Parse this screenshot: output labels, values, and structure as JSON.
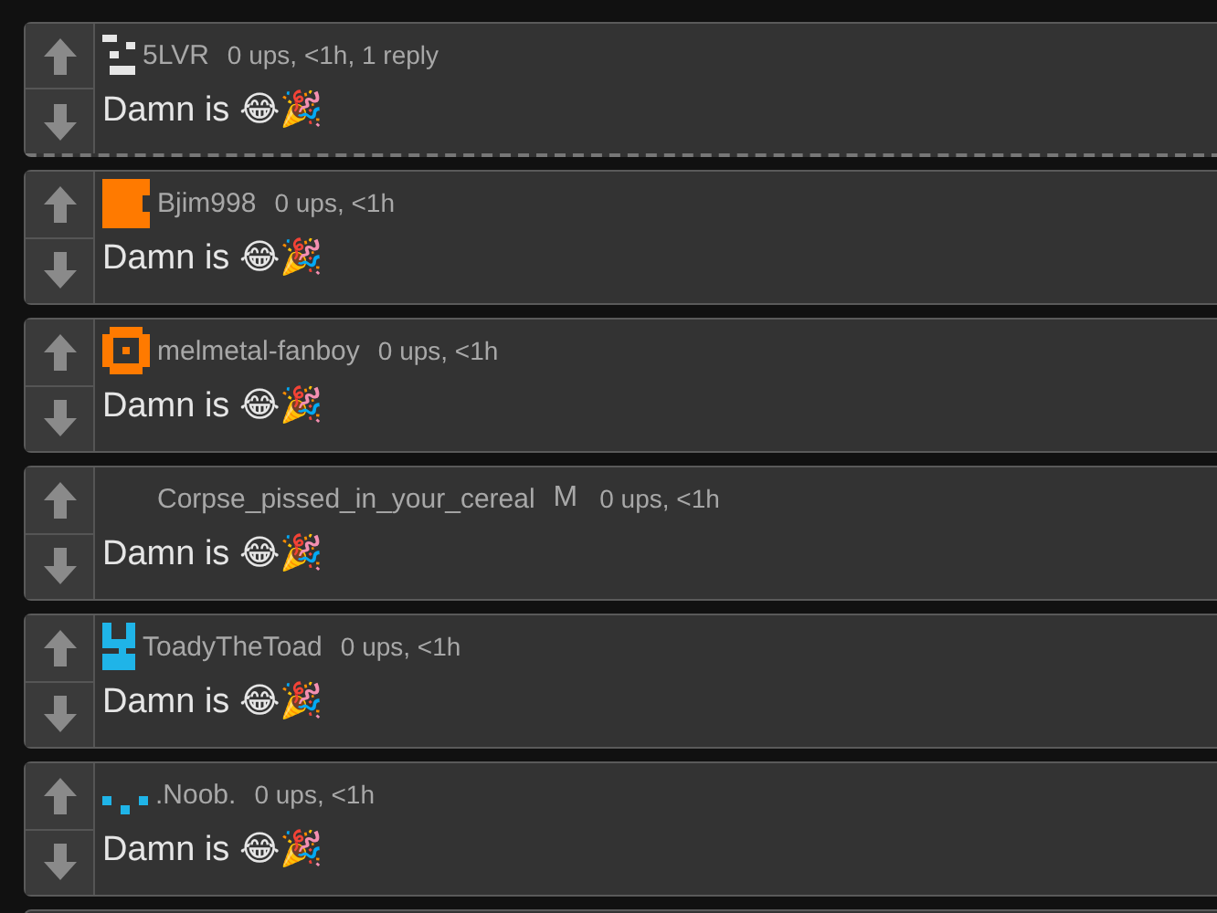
{
  "comments": [
    {
      "username": "5LVR",
      "avatar": {
        "kind": "bars",
        "color": "#e6e6e6"
      },
      "meta": "0 ups, <1h, 1 reply",
      "body": "Damn is 😂🎉",
      "has_replies": true
    },
    {
      "username": "Bjim998",
      "avatar": {
        "kind": "block",
        "color": "#ff7a00"
      },
      "meta": "0 ups, <1h",
      "body": "Damn is 😂🎉",
      "has_replies": false
    },
    {
      "username": "melmetal-fanboy",
      "avatar": {
        "kind": "ring",
        "color": "#ff7a00"
      },
      "meta": "0 ups, <1h",
      "body": "Damn is 😂🎉",
      "has_replies": false
    },
    {
      "username": "Corpse_pissed_in_your_cereal",
      "badge": "M",
      "meta": "0 ups, <1h",
      "body": "Damn is 😂🎉",
      "has_replies": false
    },
    {
      "username": "ToadyTheToad",
      "avatar": {
        "kind": "glyph",
        "color": "#1fb4e8"
      },
      "meta": "0 ups, <1h",
      "body": "Damn is 😂🎉",
      "has_replies": false
    },
    {
      "username": ".Noob.",
      "avatar": {
        "kind": "dots",
        "color": "#1fb4e8"
      },
      "meta": "0 ups, <1h",
      "body": "Damn is 😂🎉",
      "has_replies": false
    }
  ]
}
